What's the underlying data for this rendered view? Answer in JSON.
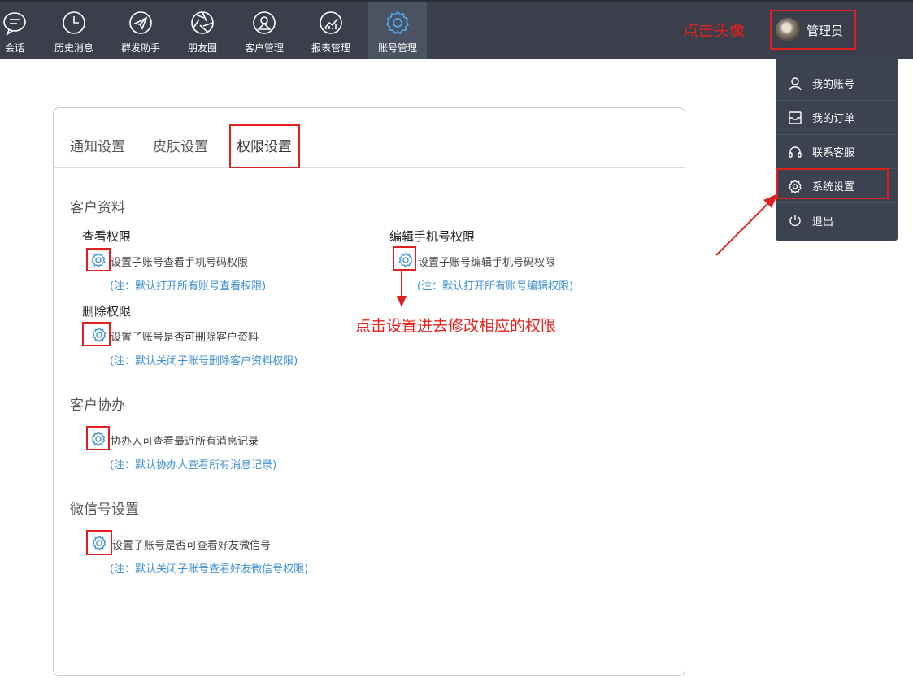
{
  "nav": {
    "items": [
      {
        "label": "会话",
        "icon": "chat-icon"
      },
      {
        "label": "历史消息",
        "icon": "clock-icon"
      },
      {
        "label": "群发助手",
        "icon": "paper-plane-icon"
      },
      {
        "label": "朋友圈",
        "icon": "aperture-icon"
      },
      {
        "label": "客户管理",
        "icon": "contact-icon"
      },
      {
        "label": "报表管理",
        "icon": "report-chart-icon"
      },
      {
        "label": "账号管理",
        "icon": "gear-icon"
      }
    ],
    "active": "账号管理"
  },
  "annotations": {
    "avatar_hint": "点击头像",
    "settings_hint": "点击设置进去修改相应的权限"
  },
  "user": {
    "name": "管理员"
  },
  "menu": {
    "items": [
      {
        "label": "我的账号",
        "icon": "user-icon"
      },
      {
        "label": "我的订单",
        "icon": "inbox-icon"
      },
      {
        "label": "联系客服",
        "icon": "headset-icon"
      },
      {
        "label": "系统设置",
        "icon": "gear-icon"
      },
      {
        "label": "退出",
        "icon": "power-icon"
      }
    ]
  },
  "tabs": [
    "通知设置",
    "皮肤设置",
    "权限设置"
  ],
  "active_tab": "权限设置",
  "sections": {
    "customer_data": {
      "title": "客户资料",
      "view": {
        "title": "查看权限",
        "desc": "设置子账号查看手机号码权限",
        "note": "(注：默认打开所有账号查看权限)"
      },
      "edit_phone": {
        "title": "编辑手机号权限",
        "desc": "设置子账号编辑手机号码权限",
        "note": "(注：默认打开所有账号编辑权限)"
      },
      "delete": {
        "title": "删除权限",
        "desc": "设置子账号是否可删除客户资料",
        "note": "(注：默认关闭子账号删除客户资料权限)"
      }
    },
    "collaboration": {
      "title": "客户协办",
      "desc": "协办人可查看最近所有消息记录",
      "note": "(注：默认协办人查看所有消息记录)"
    },
    "wechat": {
      "title": "微信号设置",
      "desc": "设置子账号是否可查看好友微信号",
      "note": "(注：默认关闭子账号查看好友微信号权限)"
    }
  },
  "colors": {
    "topbar": "#3a3f4b",
    "accent_blue": "#3d8fd6",
    "annotation_red": "#e8201b"
  }
}
